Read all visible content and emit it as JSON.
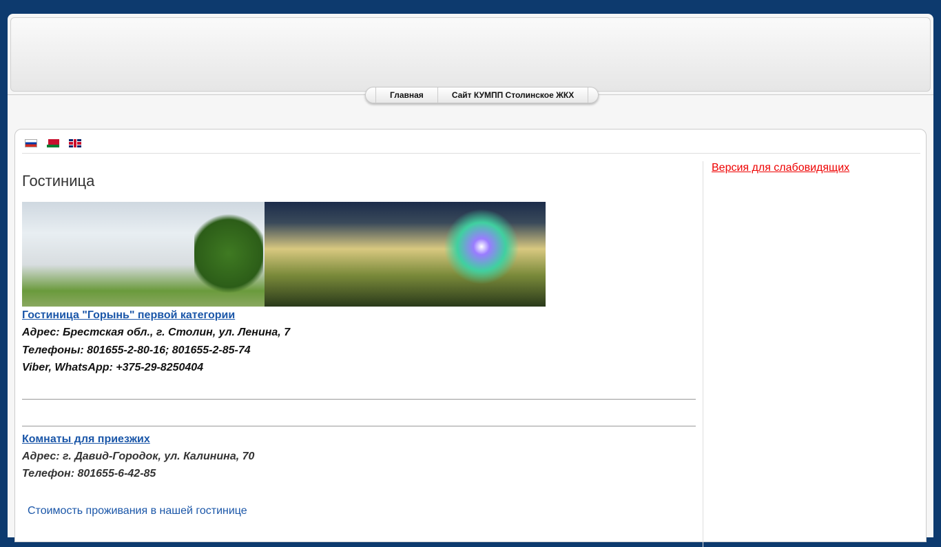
{
  "menu": {
    "items": [
      "Главная",
      "Сайт КУМПП Столинское ЖКХ"
    ]
  },
  "languages": [
    {
      "name": "ru-flag-icon"
    },
    {
      "name": "by-flag-icon"
    },
    {
      "name": "en-flag-icon"
    }
  ],
  "main": {
    "title": "Гостиница",
    "hotel": {
      "link": "Гостиница \"Горынь\" первой категории",
      "address": "Адрес: Брестская обл., г. Столин, ул. Ленина, 7",
      "phones": "Телефоны: 801655-2-80-16; 801655-2-85-74",
      "messengers": "Viber, WhatsApp: +375-29-8250404"
    },
    "rooms": {
      "link": "Комнаты для приезжих",
      "address": "Адрес: г. Давид-Городок, ул. Калинина, 70",
      "phone": "Телефон: 801655-6-42-85"
    },
    "price_link": "Стоимость проживания в нашей гостинице"
  },
  "sidebar": {
    "accessibility_link": "Версия для слабовидящих"
  },
  "colors": {
    "background": "#0d3a6e",
    "link": "#1a56a8",
    "accessibility": "#e00000"
  }
}
